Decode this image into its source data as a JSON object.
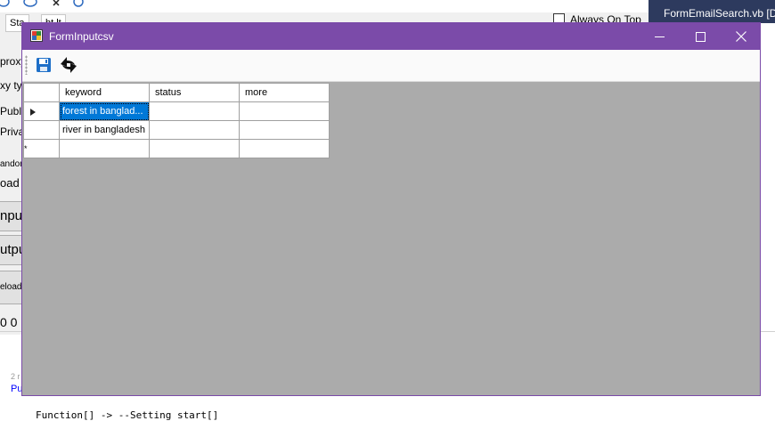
{
  "background_app": {
    "tabs": [
      "Sta",
      "ht.lt"
    ],
    "always_on_top_label": "Always On Top",
    "vs_tab_label": "FormEmailSearch.vb [D",
    "left_labels": [
      "proxy",
      "xy ty",
      "Publi",
      "Priva",
      "andor",
      "oad",
      "npu",
      "utpu",
      "eload",
      "0  0"
    ],
    "code_lines": [
      "2 r",
      "Pu",
      "Function[] -> --Setting start[] "
    ]
  },
  "window": {
    "title": "FormInputcsv",
    "controls": {
      "minimize": "minimize-icon",
      "maximize": "maximize-icon",
      "close": "close-icon"
    },
    "toolbar": {
      "buttons": [
        "save-icon",
        "refresh-icon"
      ]
    },
    "grid": {
      "columns": [
        "keyword",
        "status",
        "more"
      ],
      "rows": [
        {
          "marker": "current-row-arrow",
          "keyword": "forest in banglad...",
          "status": "",
          "more": "",
          "selected": true
        },
        {
          "marker": "",
          "keyword": "river in bangladesh",
          "status": "",
          "more": "",
          "selected": false
        },
        {
          "marker": "*",
          "keyword": "",
          "status": "",
          "more": "",
          "selected": false
        }
      ]
    },
    "colors": {
      "titlebar": "#7b4ba9",
      "grid_background": "#ababab",
      "selection": "#0078d7"
    }
  }
}
